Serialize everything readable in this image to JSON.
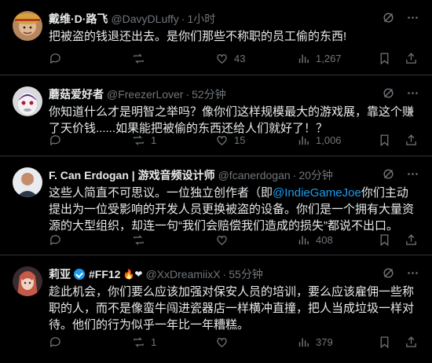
{
  "tweets": [
    {
      "name": "戴维·D·路飞",
      "handle": "@DavyDLuffy",
      "time": "1小时",
      "text": "把被盗的钱退还出去。是你们那些不称职的员工偷的东西!",
      "avatar": "luffy-avatar",
      "stats": {
        "replies": "",
        "retweets": "",
        "likes": "43",
        "views": "1,267"
      }
    },
    {
      "name": "蘑菇爱好者",
      "handle": "@FreezerLover",
      "time": "52分钟",
      "text": "你知道什么才是明智之举吗？像你们这样规模最大的游戏展，靠这个赚了天价钱......如果能把被偷的东西还给人们就好了！？",
      "avatar": "freezer-avatar",
      "stats": {
        "replies": "",
        "retweets": "1",
        "likes": "15",
        "views": "1,006"
      }
    },
    {
      "name": "F. Can Erdogan | 游戏音频设计师",
      "handle": "@fcanerdogan",
      "time": "20分钟",
      "text_before": "这些人简直不可思议。一位独立创作者（即",
      "mention": "@IndieGameJoe",
      "text_after": "你们主动提出为一位受影响的开发人员更换被盗的设备。你们是一个拥有大量资源的大型组织，却连一句“我们会赔偿我们造成的损失”都说不出口。",
      "avatar": "photo-avatar",
      "stats": {
        "replies": "",
        "retweets": "",
        "likes": "",
        "views": "408"
      }
    },
    {
      "name": "莉亚",
      "tag": "#FF12",
      "emoji": "🔥❤",
      "handle": "@XxDreamiixX",
      "time": "55分钟",
      "text": "趁此机会，你们要么应该加强对保安人员的培训，要么应该雇佣一些称职的人，而不是像蛮牛闯进瓷器店一样横冲直撞，把人当成垃圾一样对待。他们的行为似乎一年比一年糟糕。",
      "avatar": "anime-avatar",
      "stats": {
        "replies": "",
        "retweets": "1",
        "likes": "",
        "views": "379"
      }
    }
  ],
  "colors": {
    "accent": "#1d9bf0",
    "muted": "#71767b",
    "text": "#e7e9ea",
    "border": "#2f3336"
  }
}
